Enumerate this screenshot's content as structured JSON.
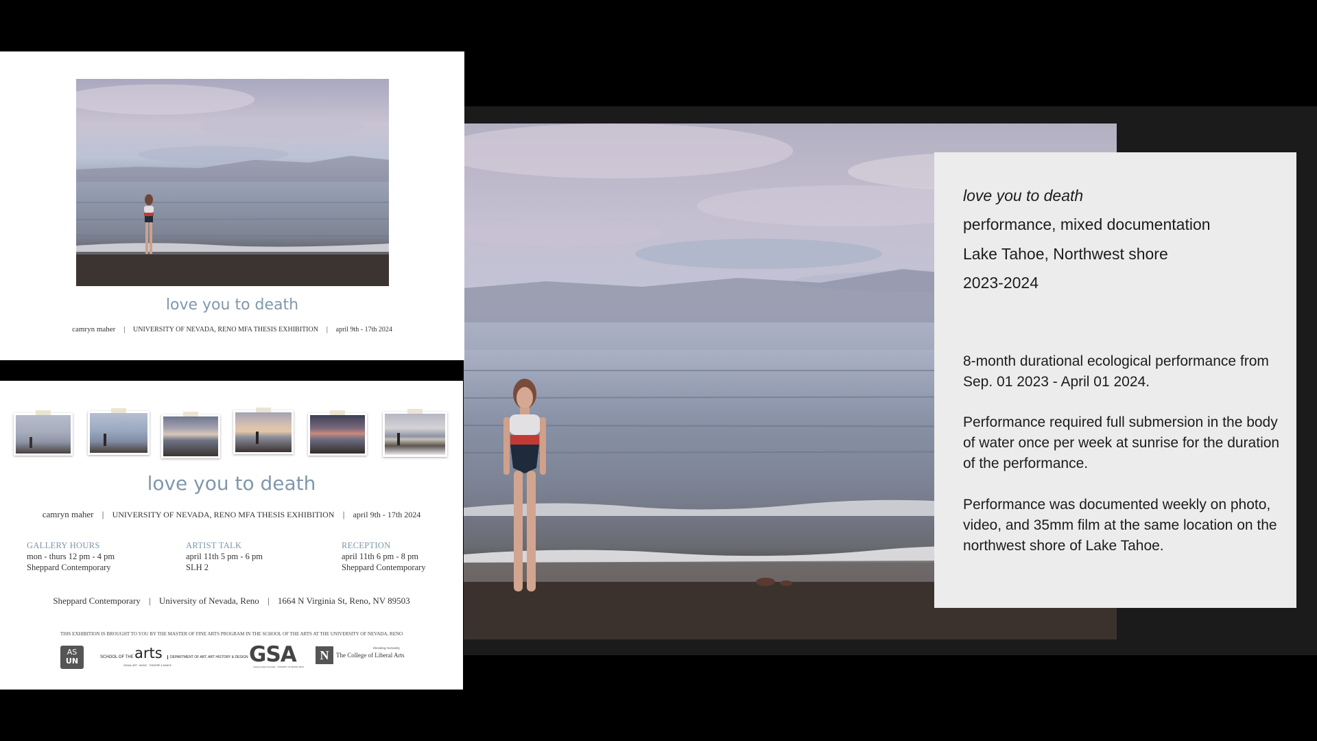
{
  "poster_top": {
    "title": "love you to death",
    "credit_artist": "camryn maher",
    "credit_sep": "|",
    "credit_program": "UNIVERSITY OF NEVADA, RENO MFA THESIS EXHIBITION",
    "credit_dates": "april 9th - 17th 2024"
  },
  "poster_bottom": {
    "title": "love you to death",
    "credit_artist": "camryn maher",
    "credit_sep": "|",
    "credit_program": "UNIVERSITY OF NEVADA, RENO MFA THESIS EXHIBITION",
    "credit_dates": "april 9th - 17th 2024",
    "gallery_hours": {
      "heading": "GALLERY HOURS",
      "line1": "mon - thurs 12 pm - 4 pm",
      "line2": "Sheppard Contemporary"
    },
    "artist_talk": {
      "heading": "ARTIST TALK",
      "line1": "april 11th 5 pm - 6 pm",
      "line2": "SLH 2"
    },
    "reception": {
      "heading": "RECEPTION",
      "line1": "april 11th 6 pm - 8 pm",
      "line2": "Sheppard Contemporary"
    },
    "venue": "Sheppard Contemporary",
    "university": "University of Nevada, Reno",
    "address": "1664 N Virginia St, Reno, NV 89503",
    "sponsor_note": "THIS EXHIBITION IS BROUGHT TO YOU BY THE MASTER OF FINE ARTS PROGRAM IN THE SCHOOL OF THE ARTS AT THE UNIVERSITY OF NEVADA, RENO",
    "logos": {
      "asun_top": "AS",
      "asun_bottom": "UN",
      "school_prefix": "SCHOOL OF THE",
      "school_main": "arts",
      "school_sub": "VISUAL ART · MUSIC · THEATRE & DANCE",
      "department": "DEPARTMENT OF ART, ART HISTORY & DESIGN",
      "gsa": "GSA",
      "gsa_sub": "Graduate Student Association · UNIVERSITY OF NEVADA, RENO",
      "n_mark": "N",
      "cla_small": "Elevating Humanity",
      "cla": "The College of Liberal Arts"
    }
  },
  "slide": {
    "title": "love you to death",
    "medium": "performance, mixed documentation",
    "location": "Lake Tahoe, Northwest shore",
    "years": "2023-2024",
    "para1": "8-month durational ecological performance from Sep. 01 2023 - April 01 2024.",
    "para2": "Performance required full submersion in the body of water once per week at sunrise for the duration of the performance.",
    "para3": "Performance was documented weekly on photo, video, and 35mm film at the same location on the northwest shore of Lake Tahoe."
  },
  "colors": {
    "poster_title": "#8097ac",
    "poster_heading": "#7c96ab",
    "slide_card": "#ececec",
    "slide_background": "#1b1b1b"
  }
}
